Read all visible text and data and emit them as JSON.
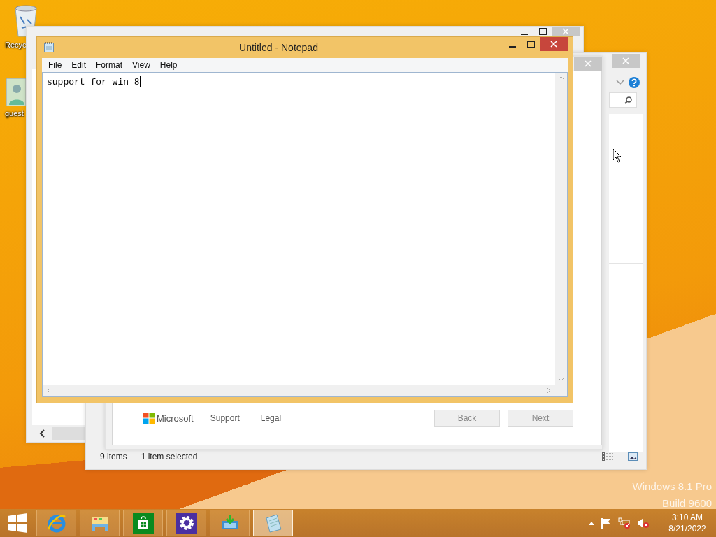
{
  "desktop": {
    "icons": [
      {
        "kind": "recycle-bin",
        "label": "Recyc"
      },
      {
        "kind": "user",
        "label": "guest"
      }
    ],
    "edition": [
      "Windows 8.1 Pro",
      "Build 9600"
    ]
  },
  "wizard_window": {
    "footer_links": [
      "Support",
      "Legal"
    ],
    "brand": "Microsoft",
    "buttons": [
      {
        "label": "Back",
        "disabled": true
      },
      {
        "label": "Next",
        "disabled": true
      }
    ]
  },
  "explorer_window": {
    "status_bar": {
      "item_count": "9 items",
      "selection": "1 item selected"
    }
  },
  "notepad": {
    "title": "Untitled - Notepad",
    "menu": [
      "File",
      "Edit",
      "Format",
      "View",
      "Help"
    ],
    "text": "support for win 8"
  },
  "taskbar": {
    "apps": [
      {
        "kind": "browser",
        "selected": false
      },
      {
        "kind": "files",
        "selected": false
      },
      {
        "kind": "store",
        "selected": false
      },
      {
        "kind": "settings",
        "selected": false
      },
      {
        "kind": "download",
        "selected": false
      },
      {
        "kind": "notepad",
        "selected": true
      }
    ],
    "time": "3:10 AM",
    "date": "8/21/2022"
  }
}
